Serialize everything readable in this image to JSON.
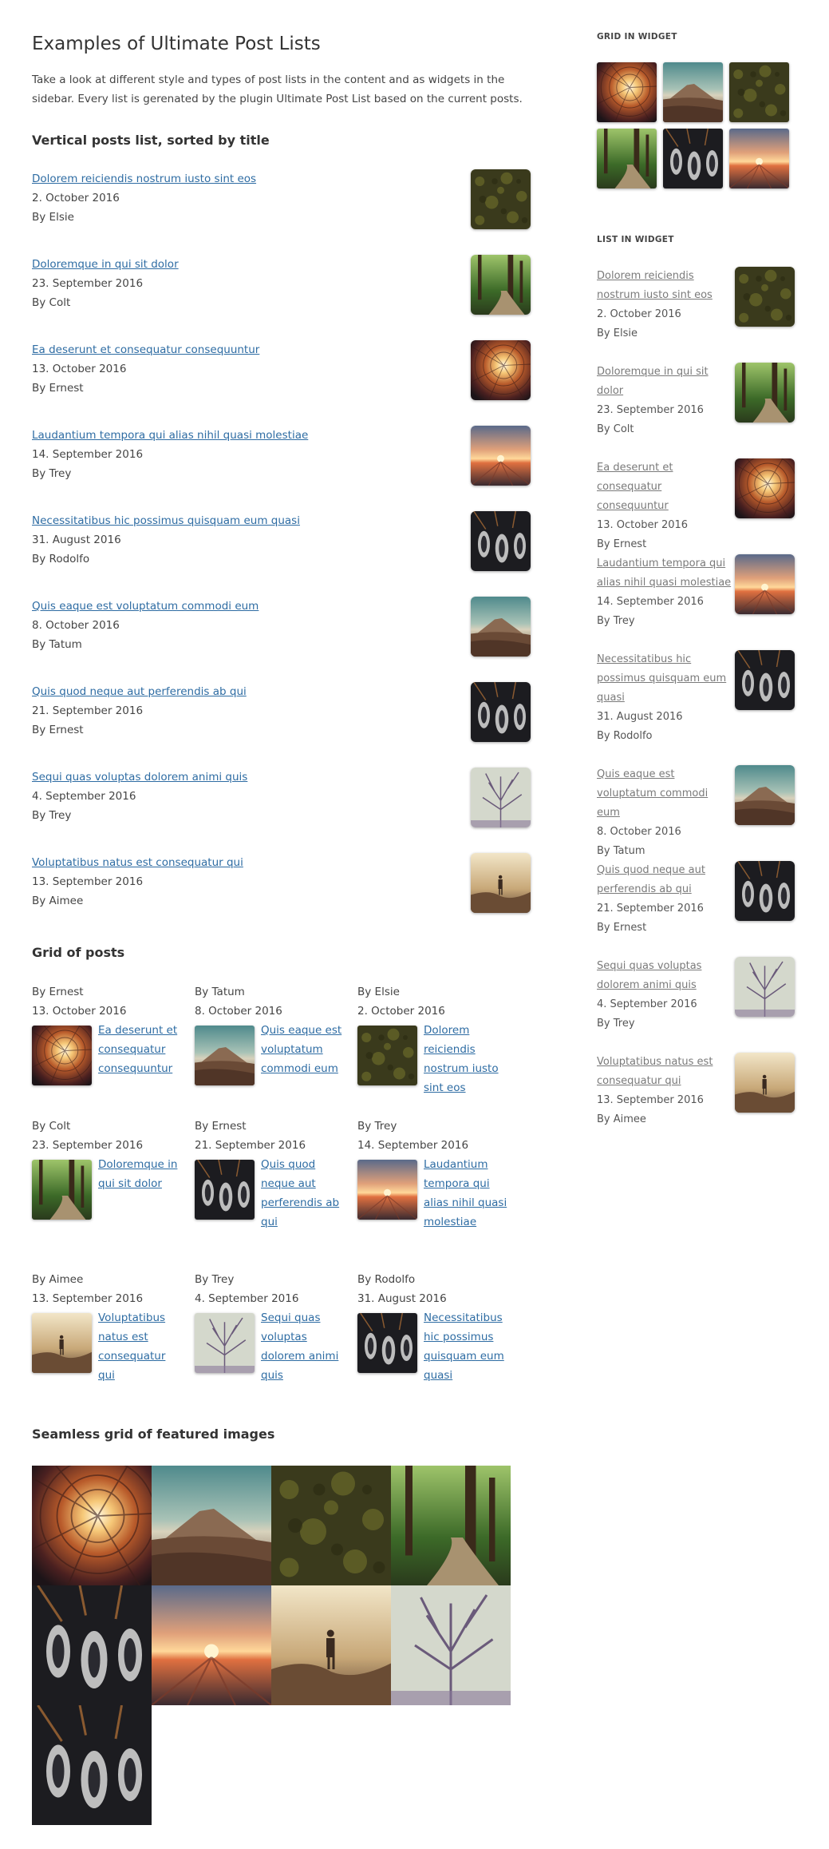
{
  "page": {
    "title": "Examples of Ultimate Post Lists",
    "intro": "Take a look at different style and types of post lists in the content and as widgets in the sidebar. Every list is gerenated by the plugin Ultimate Post List based on the current posts."
  },
  "vertical": {
    "heading": "Vertical posts list, sorted by title",
    "items": [
      {
        "title": "Dolorem reiciendis nostrum iusto sint eos",
        "date": "2. October 2016",
        "author": "By Elsie",
        "image": "moss"
      },
      {
        "title": "Doloremque in qui sit dolor",
        "date": "23. September 2016",
        "author": "By Colt",
        "image": "forest"
      },
      {
        "title": "Ea deserunt et consequatur consequuntur",
        "date": "13. October 2016",
        "author": "By Ernest",
        "image": "tower"
      },
      {
        "title": "Laudantium tempora qui alias nihil quasi molestiae",
        "date": "14. September 2016",
        "author": "By Trey",
        "image": "sunset"
      },
      {
        "title": "Necessitatibus hic possimus quisquam eum quasi",
        "date": "31. August 2016",
        "author": "By Rodolfo",
        "image": "shoes"
      },
      {
        "title": "Quis eaque est voluptatum commodi eum",
        "date": "8. October 2016",
        "author": "By Tatum",
        "image": "volcano"
      },
      {
        "title": "Quis quod neque aut perferendis ab qui",
        "date": "21. September 2016",
        "author": "By Ernest",
        "image": "shoes"
      },
      {
        "title": "Sequi quas voluptas dolorem animi quis",
        "date": "4. September 2016",
        "author": "By Trey",
        "image": "tree"
      },
      {
        "title": "Voluptatibus natus est consequatur qui",
        "date": "13. September 2016",
        "author": "By Aimee",
        "image": "hiker"
      }
    ]
  },
  "grid": {
    "heading": "Grid of posts",
    "items": [
      {
        "author": "By Ernest",
        "date": "13. October 2016",
        "title": "Ea deserunt et consequatur consequuntur",
        "image": "tower"
      },
      {
        "author": "By Tatum",
        "date": "8. October 2016",
        "title": "Quis eaque est voluptatum commodi eum",
        "image": "volcano"
      },
      {
        "author": "By Elsie",
        "date": "2. October 2016",
        "title": "Dolorem reiciendis nostrum iusto sint eos",
        "image": "moss"
      },
      {
        "author": "By Colt",
        "date": "23. September 2016",
        "title": "Doloremque in qui sit dolor",
        "image": "forest"
      },
      {
        "author": "By Ernest",
        "date": "21. September 2016",
        "title": "Quis quod neque aut perferendis ab qui",
        "image": "shoes"
      },
      {
        "author": "By Trey",
        "date": "14. September 2016",
        "title": "Laudantium tempora qui alias nihil quasi molestiae",
        "image": "sunset"
      },
      {
        "author": "By Aimee",
        "date": "13. September 2016",
        "title": "Voluptatibus natus est consequatur qui",
        "image": "hiker"
      },
      {
        "author": "By Trey",
        "date": "4. September 2016",
        "title": "Sequi quas voluptas dolorem animi quis",
        "image": "tree"
      },
      {
        "author": "By Rodolfo",
        "date": "31. August 2016",
        "title": "Necessitatibus hic possimus quisquam eum quasi",
        "image": "shoes"
      }
    ]
  },
  "seamless": {
    "heading": "Seamless grid of featured images",
    "images": [
      "tower",
      "volcano",
      "moss",
      "forest",
      "shoes",
      "sunset",
      "hiker",
      "tree",
      "shoes"
    ]
  },
  "sidebar": {
    "grid_widget": {
      "title": "GRID IN WIDGET",
      "images": [
        "tower",
        "volcano",
        "moss",
        "forest",
        "shoes",
        "sunset"
      ]
    },
    "list_widget": {
      "title": "LIST IN WIDGET",
      "items": [
        {
          "title": "Dolorem reiciendis nostrum iusto sint eos",
          "date": "2. October 2016",
          "author": "By Elsie",
          "image": "moss"
        },
        {
          "title": "Doloremque in qui sit dolor",
          "date": "23. September 2016",
          "author": "By Colt",
          "image": "forest"
        },
        {
          "title": "Ea deserunt et consequatur consequuntur",
          "date": "13. October 2016",
          "author": "By Ernest",
          "image": "tower"
        },
        {
          "title": "Laudantium tempora qui alias nihil quasi molestiae",
          "date": "14. September 2016",
          "author": "By Trey",
          "image": "sunset"
        },
        {
          "title": "Necessitatibus hic possimus quisquam eum quasi",
          "date": "31. August 2016",
          "author": "By Rodolfo",
          "image": "shoes"
        },
        {
          "title": "Quis eaque est voluptatum commodi eum",
          "date": "8. October 2016",
          "author": "By Tatum",
          "image": "volcano"
        },
        {
          "title": "Quis quod neque aut perferendis ab qui",
          "date": "21. September 2016",
          "author": "By Ernest",
          "image": "shoes"
        },
        {
          "title": "Sequi quas voluptas dolorem animi quis",
          "date": "4. September 2016",
          "author": "By Trey",
          "image": "tree"
        },
        {
          "title": "Voluptatibus natus est consequatur qui",
          "date": "13. September 2016",
          "author": "By Aimee",
          "image": "hiker"
        }
      ]
    }
  }
}
